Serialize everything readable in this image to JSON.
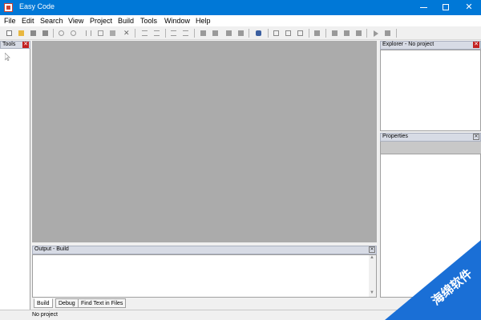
{
  "window": {
    "title": "Easy Code"
  },
  "menu": [
    "File",
    "Edit",
    "Search",
    "View",
    "Project",
    "Build",
    "Tools",
    "Window",
    "Help"
  ],
  "toolbar": {
    "icons": [
      "new-file-icon",
      "open-folder-icon",
      "save-icon",
      "save-all-icon",
      "undo-icon",
      "redo-icon",
      "cut-icon",
      "copy-icon",
      "paste-icon",
      "delete-icon",
      "indent-icon",
      "outdent-icon",
      "comment-icon",
      "uncomment-icon",
      "bookmark-icon",
      "bookmark-next-icon",
      "bookmark-prev-icon",
      "bookmark-clear-icon",
      "find-icon",
      "window-icon",
      "control-icon",
      "page-icon",
      "resource-icon",
      "compile-icon",
      "build-icon",
      "rebuild-icon",
      "run-icon",
      "stop-icon"
    ]
  },
  "panes": {
    "tools": {
      "title": "Tools"
    },
    "explorer": {
      "title": "Explorer - No project"
    },
    "properties": {
      "title": "Properties"
    },
    "output": {
      "title": "Output - Build"
    }
  },
  "output_tabs": [
    "Build",
    "Debug",
    "Find Text in Files"
  ],
  "status": {
    "text": "No project"
  },
  "watermark": {
    "text": "海绵软件"
  },
  "colors": {
    "titlebar": "#0078d7",
    "editor_bg": "#ababab",
    "watermark": "#1a6fd6"
  }
}
